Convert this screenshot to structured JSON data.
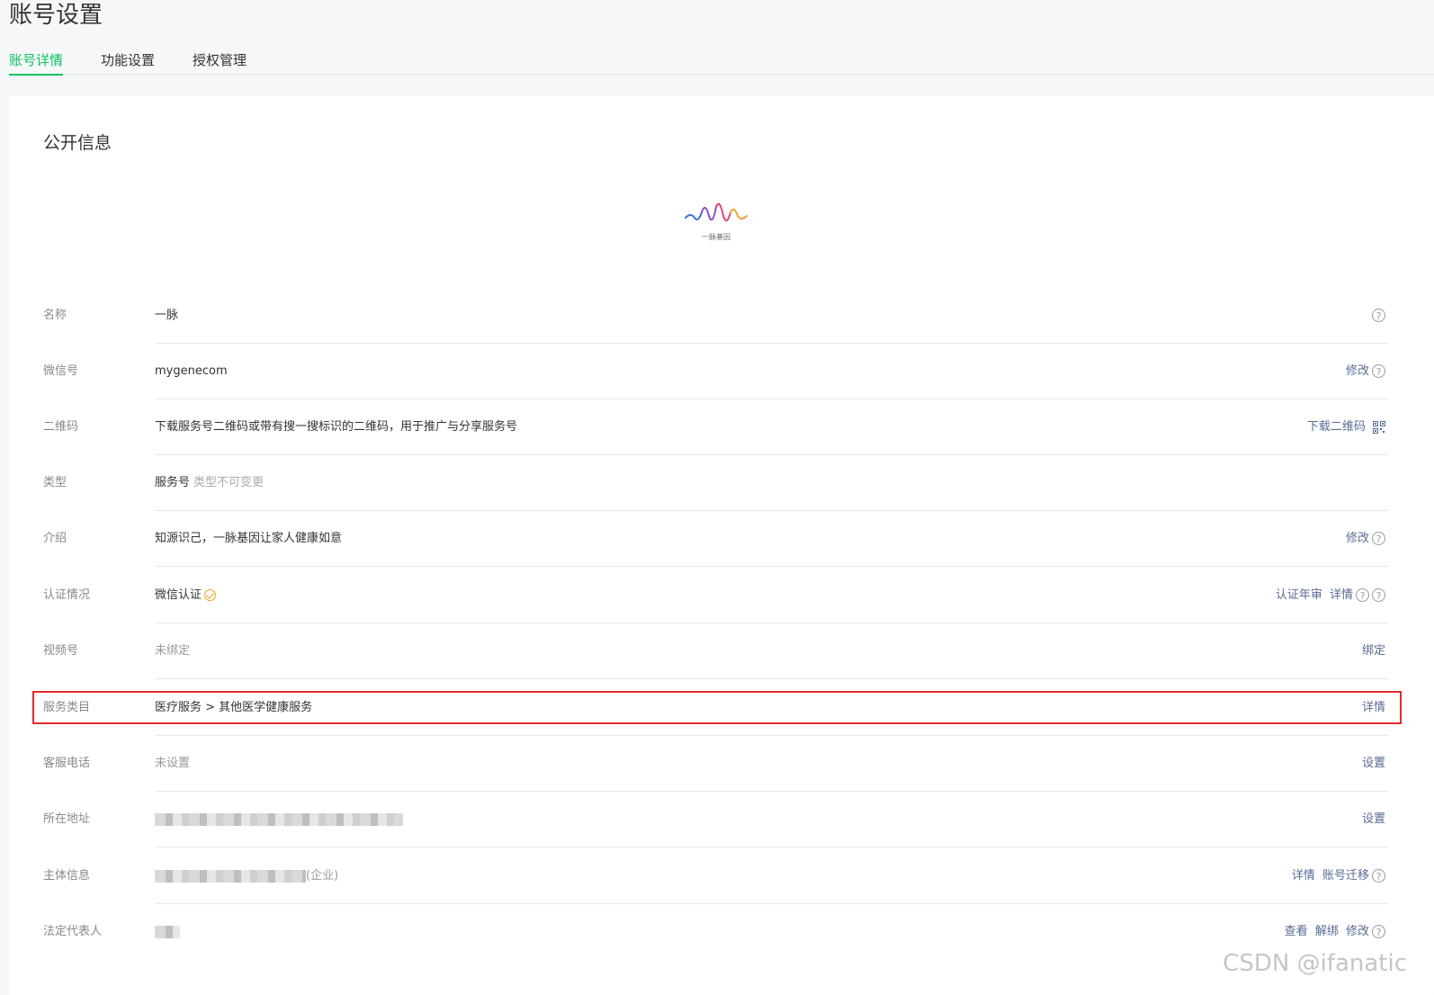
{
  "page": {
    "title": "账号设置"
  },
  "tabs": [
    {
      "label": "账号详情",
      "active": true
    },
    {
      "label": "功能设置",
      "active": false
    },
    {
      "label": "授权管理",
      "active": false
    }
  ],
  "section": {
    "title": "公开信息",
    "logo_text": "一脉基因"
  },
  "rows": {
    "name": {
      "label": "名称",
      "value": "一脉"
    },
    "wechat_id": {
      "label": "微信号",
      "value": "mygenecom",
      "edit": "修改"
    },
    "qrcode": {
      "label": "二维码",
      "value": "下载服务号二维码或带有搜一搜标识的二维码，用于推广与分享服务号",
      "download": "下载二维码"
    },
    "type": {
      "label": "类型",
      "value": "服务号",
      "note": "类型不可变更"
    },
    "intro": {
      "label": "介绍",
      "value": "知源识己，一脉基因让家人健康如意",
      "edit": "修改"
    },
    "verify": {
      "label": "认证情况",
      "value": "微信认证",
      "annual": "认证年审",
      "detail": "详情"
    },
    "channels": {
      "label": "视频号",
      "value": "未绑定",
      "bind": "绑定"
    },
    "category": {
      "label": "服务类目",
      "value": "医疗服务 > 其他医学健康服务",
      "detail": "详情"
    },
    "phone": {
      "label": "客服电话",
      "value": "未设置",
      "set": "设置"
    },
    "address": {
      "label": "所在地址",
      "set": "设置"
    },
    "entity": {
      "label": "主体信息",
      "suffix": "(企业)",
      "detail": "详情",
      "migrate": "账号迁移"
    },
    "legal": {
      "label": "法定代表人",
      "view": "查看",
      "unbind": "解绑",
      "edit": "修改"
    }
  },
  "help_glyph": "?",
  "watermark": "CSDN @ifanatic",
  "colors": {
    "accent": "#07c160",
    "link": "#576b95",
    "highlight": "#e02a2a",
    "verified": "#f0a020"
  }
}
